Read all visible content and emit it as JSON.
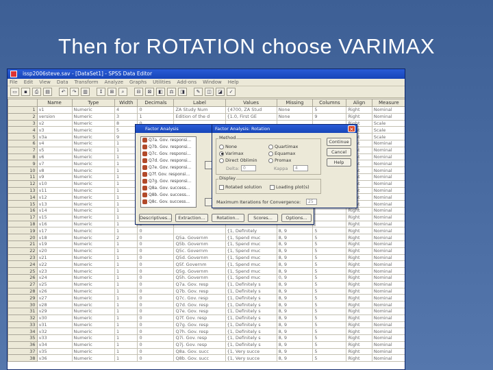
{
  "slide": {
    "title": "Then for ROTATION choose VARIMAX"
  },
  "window": {
    "title": "issp2006steve.sav - [DataSet1] - SPSS Data Editor"
  },
  "menu": [
    "File",
    "Edit",
    "View",
    "Data",
    "Transform",
    "Analyze",
    "Graphs",
    "Utilities",
    "Add-ons",
    "Window",
    "Help"
  ],
  "columns": [
    "",
    "Name",
    "Type",
    "Width",
    "Decimals",
    "Label",
    "Values",
    "Missing",
    "Columns",
    "Align",
    "Measure"
  ],
  "rows": [
    [
      "1",
      "v1",
      "Numeric",
      "4",
      "0",
      "ZA Study Num",
      "{4700, ZA Stud",
      "None",
      "5",
      "Right",
      "Nominal"
    ],
    [
      "2",
      "version",
      "Numeric",
      "3",
      "1",
      "Edition of the d",
      "{1.0, First GE",
      "None",
      "9",
      "Right",
      "Nominal"
    ],
    [
      "3",
      "v2",
      "Numeric",
      "8",
      "0",
      "",
      "",
      "",
      "",
      "Right",
      "Scale"
    ],
    [
      "4",
      "v3",
      "Numeric",
      "5",
      "0",
      "",
      "",
      "",
      "",
      "Right",
      "Scale"
    ],
    [
      "5",
      "v3a",
      "Numeric",
      "9",
      "0",
      "",
      "",
      "",
      "",
      "Right",
      "Scale"
    ],
    [
      "6",
      "v4",
      "Numeric",
      "1",
      "0",
      "",
      "",
      "",
      "",
      "Right",
      "Nominal"
    ],
    [
      "7",
      "v5",
      "Numeric",
      "1",
      "0",
      "",
      "",
      "",
      "",
      "Right",
      "Nominal"
    ],
    [
      "8",
      "v6",
      "Numeric",
      "1",
      "0",
      "",
      "",
      "",
      "",
      "Right",
      "Nominal"
    ],
    [
      "9",
      "v7",
      "Numeric",
      "1",
      "0",
      "",
      "",
      "",
      "",
      "Right",
      "Nominal"
    ],
    [
      "10",
      "v8",
      "Numeric",
      "1",
      "0",
      "",
      "",
      "",
      "",
      "Right",
      "Nominal"
    ],
    [
      "11",
      "v9",
      "Numeric",
      "1",
      "0",
      "",
      "",
      "",
      "",
      "Right",
      "Nominal"
    ],
    [
      "12",
      "v10",
      "Numeric",
      "1",
      "0",
      "",
      "",
      "",
      "",
      "Right",
      "Nominal"
    ],
    [
      "13",
      "v11",
      "Numeric",
      "1",
      "0",
      "",
      "",
      "",
      "",
      "Right",
      "Nominal"
    ],
    [
      "14",
      "v12",
      "Numeric",
      "1",
      "0",
      "",
      "",
      "",
      "",
      "Right",
      "Nominal"
    ],
    [
      "15",
      "v13",
      "Numeric",
      "1",
      "0",
      "",
      "",
      "",
      "",
      "Right",
      "Nominal"
    ],
    [
      "16",
      "v14",
      "Numeric",
      "1",
      "0",
      "",
      "",
      "",
      "",
      "Right",
      "Nominal"
    ],
    [
      "17",
      "v15",
      "Numeric",
      "1",
      "0",
      "",
      "",
      "",
      "",
      "Right",
      "Nominal"
    ],
    [
      "18",
      "v16",
      "Numeric",
      "1",
      "0",
      "",
      "",
      "",
      "",
      "Right",
      "Nominal"
    ],
    [
      "19",
      "v17",
      "Numeric",
      "1",
      "0",
      "",
      "{1, Definitely",
      "8, 9",
      "5",
      "Right",
      "Nominal"
    ],
    [
      "20",
      "v18",
      "Numeric",
      "2",
      "0",
      "Q5a. Governm",
      "{1, Spend muc",
      "8, 9",
      "5",
      "Right",
      "Nominal"
    ],
    [
      "21",
      "v19",
      "Numeric",
      "1",
      "0",
      "Q5b. Governm",
      "{1, Spend muc",
      "8, 9",
      "5",
      "Right",
      "Nominal"
    ],
    [
      "22",
      "v20",
      "Numeric",
      "1",
      "0",
      "Q5c. Governm",
      "{1, Spend muc",
      "8, 9",
      "5",
      "Right",
      "Nominal"
    ],
    [
      "23",
      "v21",
      "Numeric",
      "1",
      "0",
      "Q5d. Governm",
      "{1, Spend muc",
      "8, 9",
      "5",
      "Right",
      "Nominal"
    ],
    [
      "24",
      "v22",
      "Numeric",
      "1",
      "0",
      "Q5f. Governm",
      "{1, Spend muc",
      "8, 9",
      "5",
      "Right",
      "Nominal"
    ],
    [
      "25",
      "v23",
      "Numeric",
      "1",
      "0",
      "Q5g. Governm",
      "{1, Spend muc",
      "8, 9",
      "5",
      "Right",
      "Nominal"
    ],
    [
      "26",
      "v24",
      "Numeric",
      "1",
      "0",
      "Q5h. Governm",
      "{1, Spend muc",
      "0, 9",
      "5",
      "Right",
      "Nominal"
    ],
    [
      "27",
      "v25",
      "Numeric",
      "1",
      "0",
      "Q7a. Gov. resp",
      "{1, Definitely s",
      "8, 9",
      "5",
      "Right",
      "Nominal"
    ],
    [
      "28",
      "v26",
      "Numeric",
      "1",
      "0",
      "Q7b. Gov. resp",
      "{1, Definitely s",
      "8, 9",
      "5",
      "Right",
      "Nominal"
    ],
    [
      "29",
      "v27",
      "Numeric",
      "1",
      "0",
      "Q7c. Gov. resp",
      "{1, Definitely s",
      "8, 9",
      "5",
      "Right",
      "Nominal"
    ],
    [
      "30",
      "v28",
      "Numeric",
      "1",
      "0",
      "Q7d. Gov. resp",
      "{1, Definitely s",
      "8, 9",
      "5",
      "Right",
      "Nominal"
    ],
    [
      "31",
      "v29",
      "Numeric",
      "1",
      "0",
      "Q7e. Gov. resp",
      "{1, Definitely s",
      "8, 9",
      "5",
      "Right",
      "Nominal"
    ],
    [
      "32",
      "v30",
      "Numeric",
      "1",
      "0",
      "Q7f. Gov. resp",
      "{1, Definitely s",
      "8, 9",
      "5",
      "Right",
      "Nominal"
    ],
    [
      "33",
      "v31",
      "Numeric",
      "1",
      "0",
      "Q7g. Gov. resp",
      "{1, Definitely s",
      "8, 9",
      "5",
      "Right",
      "Nominal"
    ],
    [
      "34",
      "v32",
      "Numeric",
      "1",
      "0",
      "Q7h. Gov. resp",
      "{1, Definitely s",
      "8, 9",
      "5",
      "Right",
      "Nominal"
    ],
    [
      "35",
      "v33",
      "Numeric",
      "1",
      "0",
      "Q7i. Gov. resp",
      "{1, Definitely s",
      "8, 9",
      "5",
      "Right",
      "Nominal"
    ],
    [
      "36",
      "v34",
      "Numeric",
      "1",
      "0",
      "Q7j. Gov. resp",
      "{1, Definitely s",
      "8, 9",
      "5",
      "Right",
      "Nominal"
    ],
    [
      "37",
      "v35",
      "Numeric",
      "1",
      "0",
      "Q8a. Gov. succ",
      "{1, Very succe",
      "8, 9",
      "5",
      "Right",
      "Nominal"
    ],
    [
      "38",
      "v36",
      "Numeric",
      "1",
      "0",
      "Q8b. Gov. succ",
      "{1, Very succe",
      "8, 9",
      "5",
      "Right",
      "Nominal"
    ]
  ],
  "factor_dialog": {
    "title": "Factor Analysis",
    "list": [
      "Q7a. Gov. responsi...",
      "Q7b. Gov. responsi...",
      "Q7c. Gov. responsi...",
      "Q7d. Gov. responsi...",
      "Q7e. Gov. responsi...",
      "Q7f. Gov. responsi...",
      "Q7g. Gov. responsi...",
      "Q8a. Gov. success...",
      "Q8b. Gov. success...",
      "Q8c. Gov. success..."
    ],
    "buttons": {
      "descriptives": "Descriptives...",
      "extraction": "Extraction...",
      "rotation": "Rotation...",
      "scores": "Scores...",
      "options": "Options..."
    }
  },
  "rotation_dialog": {
    "title": "Factor Analysis: Rotation",
    "method_label": "Method",
    "methods": {
      "none": "None",
      "varimax": "Varimax",
      "oblimin": "Direct Oblimin",
      "quartimax": "Quartimax",
      "equamax": "Equamax",
      "promax": "Promax"
    },
    "delta_label": "Delta:",
    "delta_value": "0",
    "kappa_label": "Kappa",
    "kappa_value": "4",
    "display_label": "Display",
    "rotated_solution": "Rotated solution",
    "loading_plots": "Loading plot(s)",
    "max_iter_label": "Maximum Iterations for Convergence:",
    "max_iter_value": "25",
    "buttons": {
      "continue": "Continue",
      "cancel": "Cancel",
      "help": "Help"
    }
  }
}
